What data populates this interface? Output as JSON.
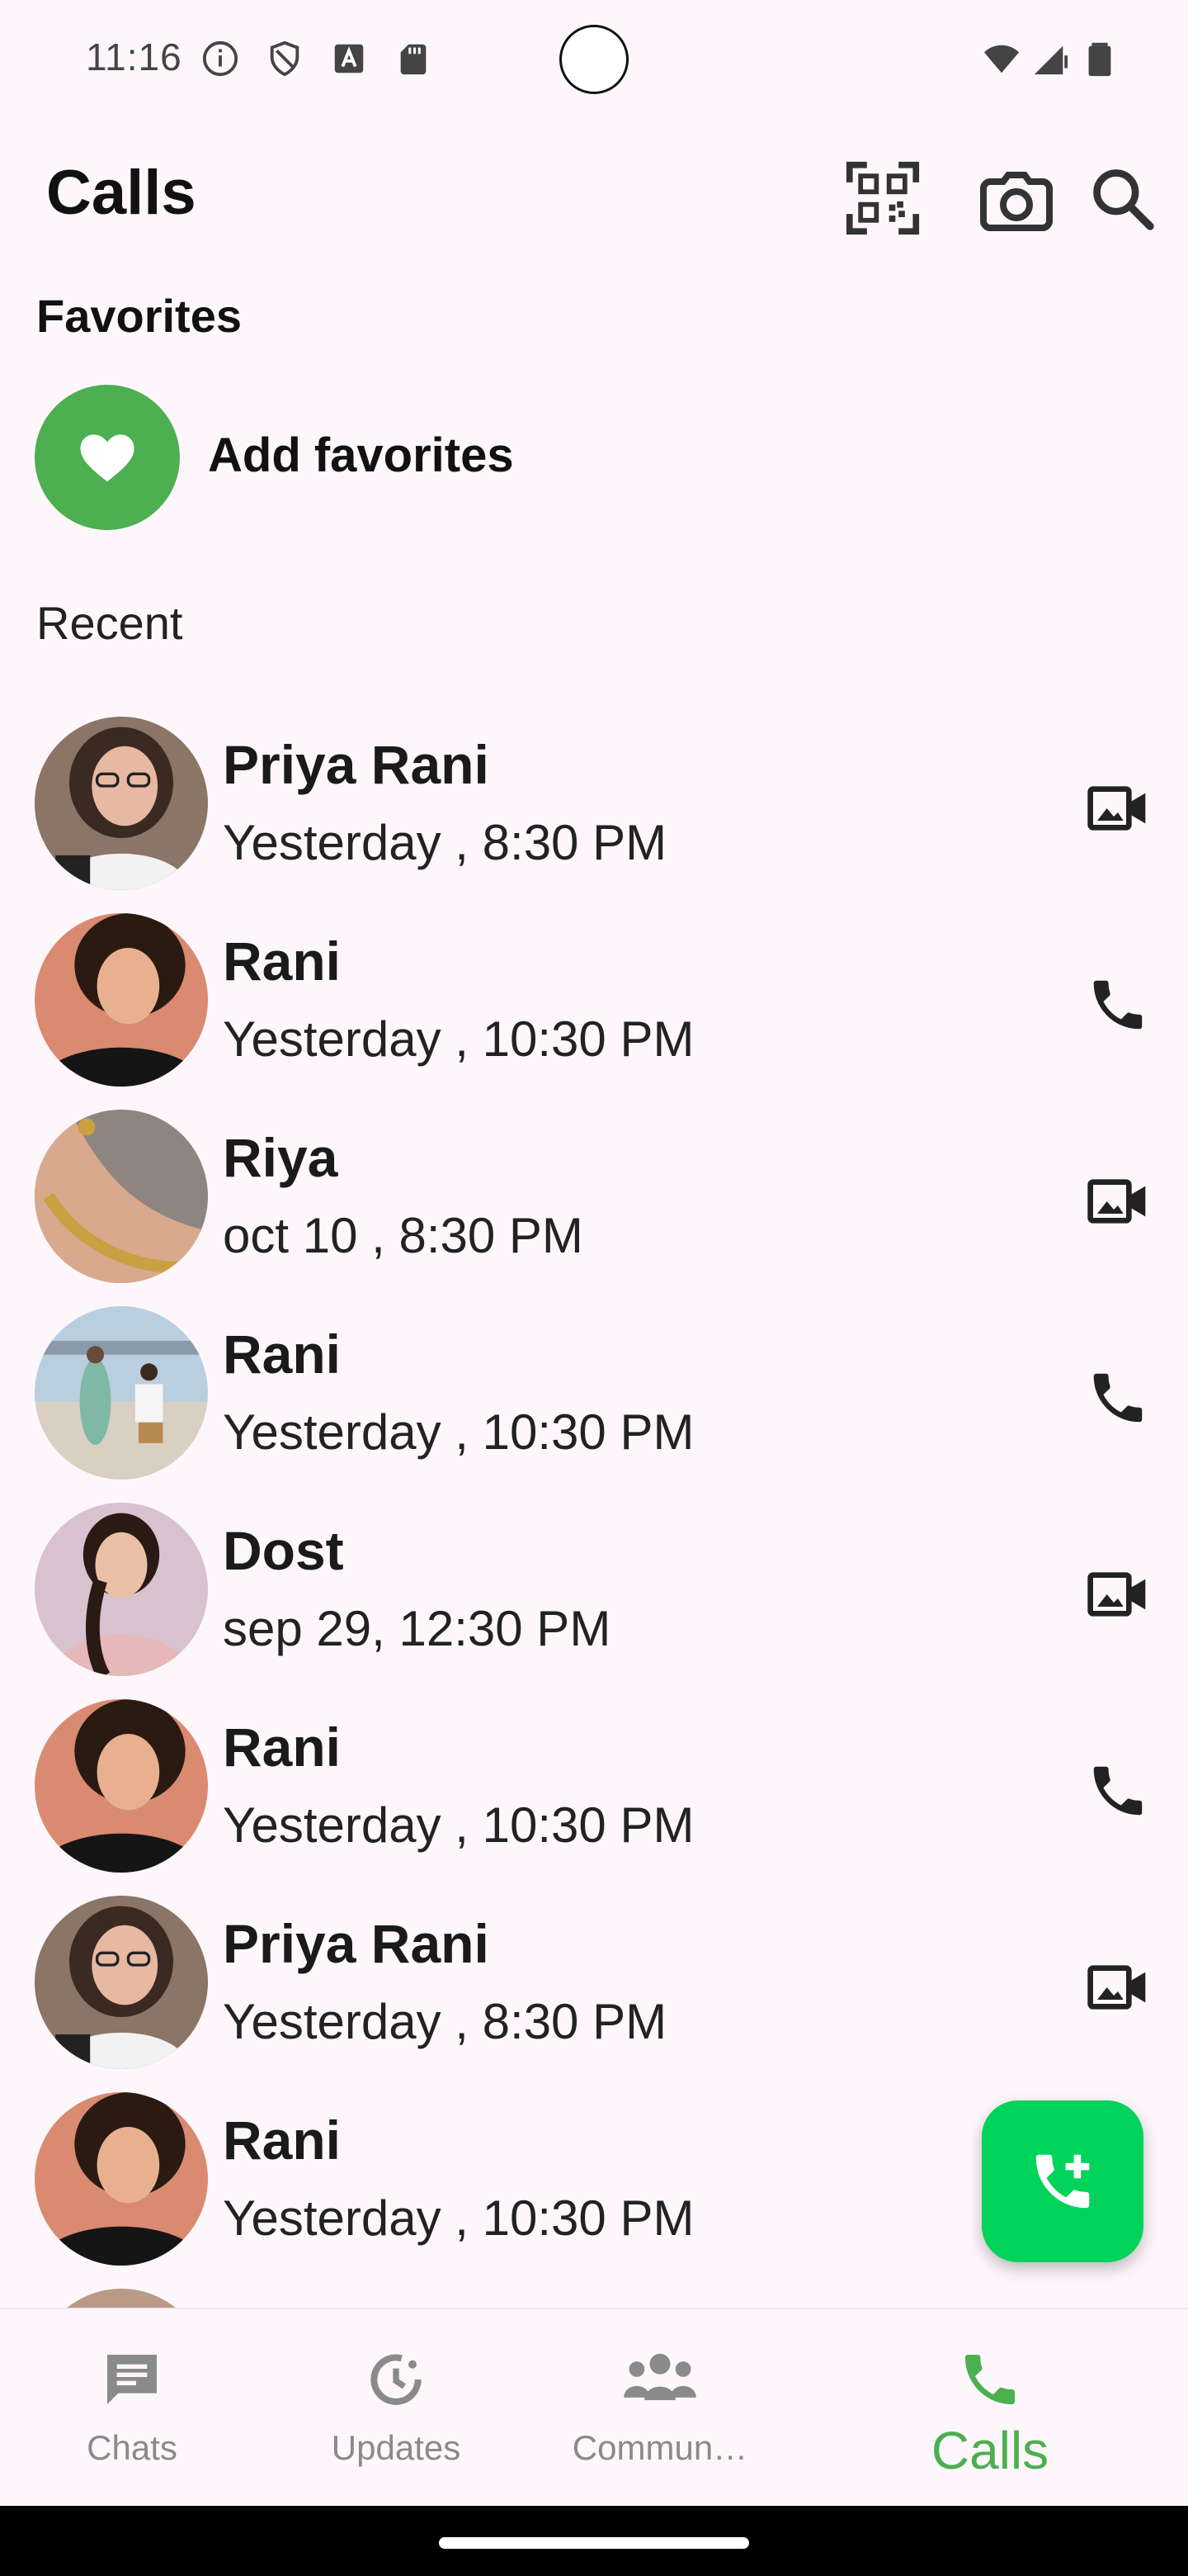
{
  "status_bar": {
    "time": "11:16",
    "left_icons": [
      "info-icon",
      "shield-icon",
      "font-a-icon",
      "sd-card-icon"
    ],
    "right_icons": [
      "wifi-icon",
      "signal-icon",
      "battery-icon"
    ]
  },
  "header": {
    "title": "Calls",
    "actions": [
      "qr-code-icon",
      "camera-icon",
      "search-icon"
    ]
  },
  "favorites": {
    "heading": "Favorites",
    "add_label": "Add favorites",
    "accent": "#4caf50"
  },
  "recent": {
    "heading": "Recent",
    "calls": [
      {
        "name": "Priya Rani",
        "time": "Yesterday , 8:30 PM",
        "type": "video"
      },
      {
        "name": "Rani",
        "time": "Yesterday , 10:30 PM",
        "type": "voice"
      },
      {
        "name": "Riya",
        "time": "oct 10 , 8:30 PM",
        "type": "video"
      },
      {
        "name": "Rani",
        "time": "Yesterday , 10:30 PM",
        "type": "voice"
      },
      {
        "name": "Dost",
        "time": "sep 29, 12:30 PM",
        "type": "video"
      },
      {
        "name": "Rani",
        "time": "Yesterday , 10:30 PM",
        "type": "voice"
      },
      {
        "name": "Priya Rani",
        "time": "Yesterday , 8:30 PM",
        "type": "video"
      },
      {
        "name": "Rani",
        "time": "Yesterday , 10:30 PM",
        "type": "voice"
      }
    ]
  },
  "fab": {
    "icon": "add-call-icon",
    "color": "#00d35a"
  },
  "bottom_nav": {
    "items": [
      {
        "label": "Chats",
        "icon": "chat-icon"
      },
      {
        "label": "Updates",
        "icon": "updates-icon"
      },
      {
        "label": "Commun…",
        "icon": "communities-icon"
      },
      {
        "label": "Calls",
        "icon": "phone-icon",
        "active": true
      }
    ],
    "active_color": "#4caf50"
  }
}
